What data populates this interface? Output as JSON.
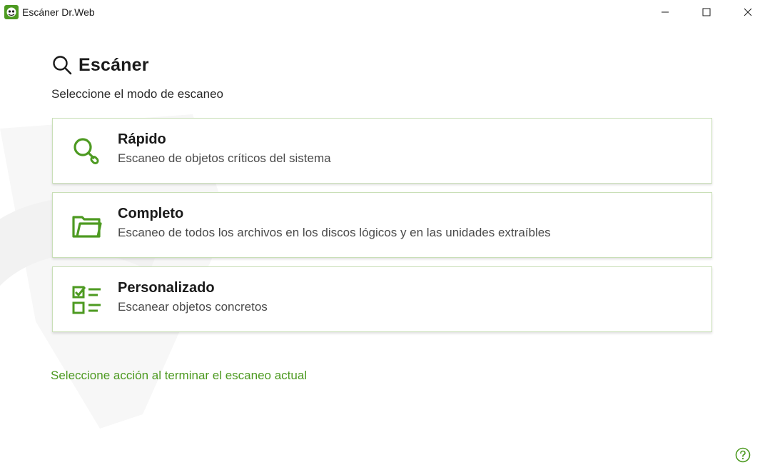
{
  "window": {
    "title": "Escáner Dr.Web",
    "controls": [
      "minimize",
      "maximize",
      "close"
    ]
  },
  "page": {
    "title": "Escáner",
    "subtitle": "Seleccione el modo de escaneo"
  },
  "modes": [
    {
      "title": "Rápido",
      "description": "Escaneo de objetos críticos del sistema",
      "icon": "magnifier-icon"
    },
    {
      "title": "Completo",
      "description": "Escaneo de todos los archivos en los discos lógicos y en las unidades extraíbles",
      "icon": "folder-icon"
    },
    {
      "title": "Personalizado",
      "description": "Escanear objetos concretos",
      "icon": "checklist-icon"
    }
  ],
  "action_link": "Seleccione acción al terminar el escaneo actual",
  "help_icon": "help-icon",
  "colors": {
    "accent": "#4d9a21",
    "card_border": "#c9dfb7",
    "text": "#1a1a1a"
  }
}
